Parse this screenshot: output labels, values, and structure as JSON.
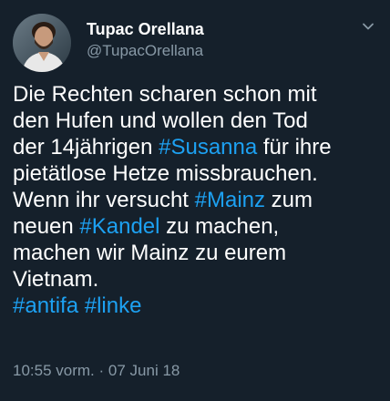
{
  "user": {
    "name": "Tupac Orellana",
    "handle": "@TupacOrellana"
  },
  "tweet": {
    "lines": [
      [
        {
          "t": "Die Rechten scharen schon mit"
        }
      ],
      [
        {
          "t": "den Hufen und wollen den Tod"
        }
      ],
      [
        {
          "t": "der 14jährigen "
        },
        {
          "t": "#Susanna",
          "tag": true
        },
        {
          "t": " für ihre"
        }
      ],
      [
        {
          "t": "pietätlose Hetze missbrauchen."
        }
      ],
      [
        {
          "t": "Wenn ihr versucht "
        },
        {
          "t": "#Mainz",
          "tag": true
        },
        {
          "t": " zum"
        }
      ],
      [
        {
          "t": "neuen "
        },
        {
          "t": "#Kandel",
          "tag": true
        },
        {
          "t": " zu machen,"
        }
      ],
      [
        {
          "t": "machen wir Mainz zu eurem"
        }
      ],
      [
        {
          "t": "Vietnam."
        }
      ],
      [
        {
          "t": "#antifa",
          "tag": true
        },
        {
          "t": " "
        },
        {
          "t": "#linke",
          "tag": true
        }
      ]
    ],
    "time": "10:55 vorm.",
    "separator": "·",
    "date": "07 Juni 18"
  },
  "colors": {
    "background": "#15202b",
    "text": "#ffffff",
    "secondary": "#8899a6",
    "hashtag": "#1da1f2"
  },
  "icons": {
    "menu": "chevron-down-icon",
    "avatar": "profile-photo"
  }
}
